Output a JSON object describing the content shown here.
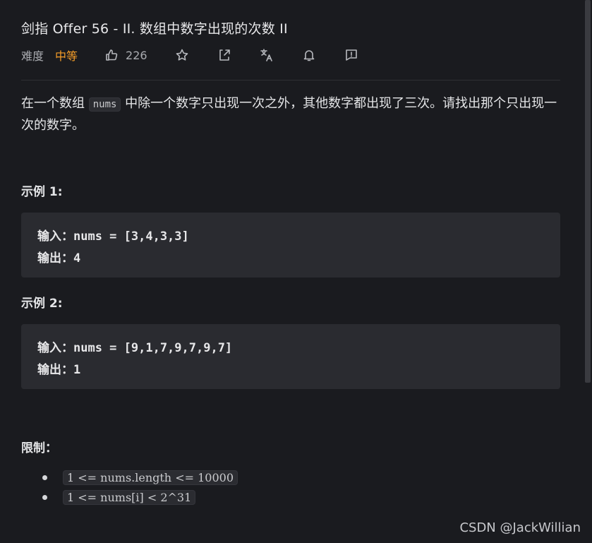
{
  "problem": {
    "title": "剑指 Offer 56 - II. 数组中数字出现的次数 II",
    "difficulty_label": "难度",
    "difficulty": "中等",
    "likes": "226",
    "icons": [
      "thumb-up-icon",
      "star-icon",
      "share-icon",
      "translate-icon",
      "bell-icon",
      "feedback-icon"
    ]
  },
  "description": {
    "part1": "在一个数组 ",
    "code": "nums",
    "part2": " 中除一个数字只出现一次之外，其他数字都出现了三次。请找出那个只出现一次的数字。"
  },
  "examples": [
    {
      "heading": "示例 1:",
      "input": "输入：nums = [3,4,3,3]",
      "output": "输出：4"
    },
    {
      "heading": "示例 2:",
      "input": "输入：nums = [9,1,7,9,7,9,7]",
      "output": "输出：1"
    }
  ],
  "limits": {
    "heading": "限制：",
    "items": [
      "1 <= nums.length <= 10000",
      "1 <= nums[i] < 2^31"
    ]
  },
  "watermark": "CSDN @JackWillian",
  "colors": {
    "background": "#1a1b1f",
    "difficulty": "#f59d28",
    "code_bg": "#2a2b30"
  }
}
